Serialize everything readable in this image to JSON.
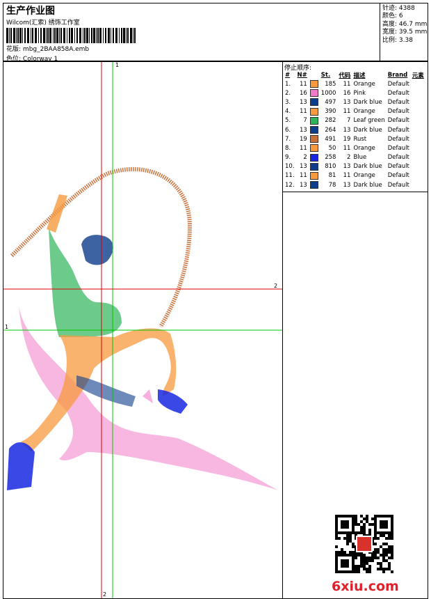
{
  "header": {
    "title": "生产作业图",
    "company": "Wilcom(汇索) 绣饰工作室",
    "design_label": "花版:",
    "design_file": "mbg_2BAA858A.emb",
    "colorway_label": "色位:",
    "colorway": "Colorway 1"
  },
  "stats": [
    {
      "label": "针迹:",
      "value": "4388"
    },
    {
      "label": "颜色:",
      "value": "6"
    },
    {
      "label": "高度:",
      "value": "46.7 mm"
    },
    {
      "label": "宽度:",
      "value": "39.5 mm"
    },
    {
      "label": "比例:",
      "value": "3.38"
    }
  ],
  "canvas": {
    "axis_labels": {
      "top_green": "1",
      "right_red": "2",
      "left_green": "1",
      "bottom_red": "2"
    }
  },
  "stop_sequence": {
    "title": "停止顺序:",
    "columns": [
      "#",
      "N#",
      "St.",
      "代码",
      "描述",
      "Brand",
      "元素"
    ],
    "rows": [
      {
        "idx": "1.",
        "n": "11",
        "color": "#f79a3e",
        "st": "185",
        "code": "11",
        "desc": "Orange",
        "brand": "Default"
      },
      {
        "idx": "2.",
        "n": "16",
        "color": "#f07bc8",
        "st": "1000",
        "code": "16",
        "desc": "Pink",
        "brand": "Default"
      },
      {
        "idx": "3.",
        "n": "13",
        "color": "#0d3c8c",
        "st": "497",
        "code": "13",
        "desc": "Dark blue",
        "brand": "Default"
      },
      {
        "idx": "4.",
        "n": "11",
        "color": "#f79a3e",
        "st": "390",
        "code": "11",
        "desc": "Orange",
        "brand": "Default"
      },
      {
        "idx": "5.",
        "n": "7",
        "color": "#2db45a",
        "st": "282",
        "code": "7",
        "desc": "Leaf green",
        "brand": "Default"
      },
      {
        "idx": "6.",
        "n": "13",
        "color": "#0d3c8c",
        "st": "264",
        "code": "13",
        "desc": "Dark blue",
        "brand": "Default"
      },
      {
        "idx": "7.",
        "n": "19",
        "color": "#c8703a",
        "st": "491",
        "code": "19",
        "desc": "Rust",
        "brand": "Default"
      },
      {
        "idx": "8.",
        "n": "11",
        "color": "#f79a3e",
        "st": "50",
        "code": "11",
        "desc": "Orange",
        "brand": "Default"
      },
      {
        "idx": "9.",
        "n": "2",
        "color": "#1828e0",
        "st": "258",
        "code": "2",
        "desc": "Blue",
        "brand": "Default"
      },
      {
        "idx": "10.",
        "n": "13",
        "color": "#0d3c8c",
        "st": "810",
        "code": "13",
        "desc": "Dark blue",
        "brand": "Default"
      },
      {
        "idx": "11.",
        "n": "11",
        "color": "#f79a3e",
        "st": "81",
        "code": "11",
        "desc": "Orange",
        "brand": "Default"
      },
      {
        "idx": "12.",
        "n": "13",
        "color": "#0d3c8c",
        "st": "78",
        "code": "13",
        "desc": "Dark blue",
        "brand": "Default"
      }
    ]
  },
  "qr": {
    "icon": "qr-code-icon",
    "seal_text": "印"
  },
  "watermark": "6xiu.com",
  "colors": {
    "guide_red": "#e00000",
    "guide_green": "#00c800",
    "watermark": "#e0202a"
  }
}
